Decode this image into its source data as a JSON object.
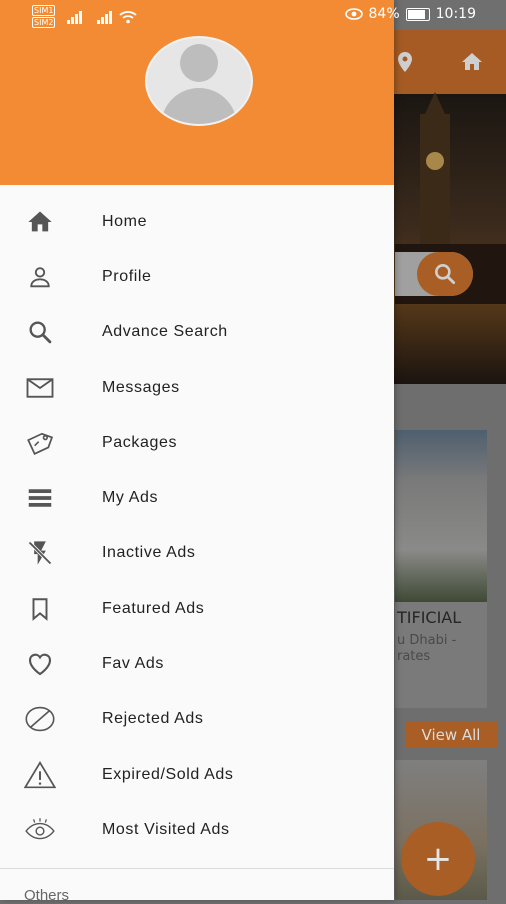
{
  "status_bar": {
    "sim1": "SIM1",
    "sim2": "SIM2",
    "battery": "84%",
    "time": "10:19",
    "battery_level": 0.84
  },
  "drawer": {
    "items": [
      {
        "label": "Home",
        "icon": "home-icon"
      },
      {
        "label": "Profile",
        "icon": "profile-icon"
      },
      {
        "label": "Advance Search",
        "icon": "search-icon"
      },
      {
        "label": "Messages",
        "icon": "mail-icon"
      },
      {
        "label": "Packages",
        "icon": "tag-icon"
      },
      {
        "label": "My Ads",
        "icon": "list-icon"
      },
      {
        "label": "Inactive Ads",
        "icon": "flash-off-icon"
      },
      {
        "label": "Featured Ads",
        "icon": "bookmark-icon"
      },
      {
        "label": "Fav Ads",
        "icon": "heart-icon"
      },
      {
        "label": "Rejected Ads",
        "icon": "block-icon"
      },
      {
        "label": "Expired/Sold  Ads",
        "icon": "warning-icon"
      },
      {
        "label": "Most Visited Ads",
        "icon": "eye-icon"
      }
    ],
    "section_others": "Others"
  },
  "background": {
    "card_title": "TIFICIAL",
    "card_subtitle_1": "u Dhabi -",
    "card_subtitle_2": "rates",
    "view_all": "View All",
    "fab": "+"
  },
  "colors": {
    "accent": "#f28b34",
    "drawer_bg": "#fafafa"
  }
}
